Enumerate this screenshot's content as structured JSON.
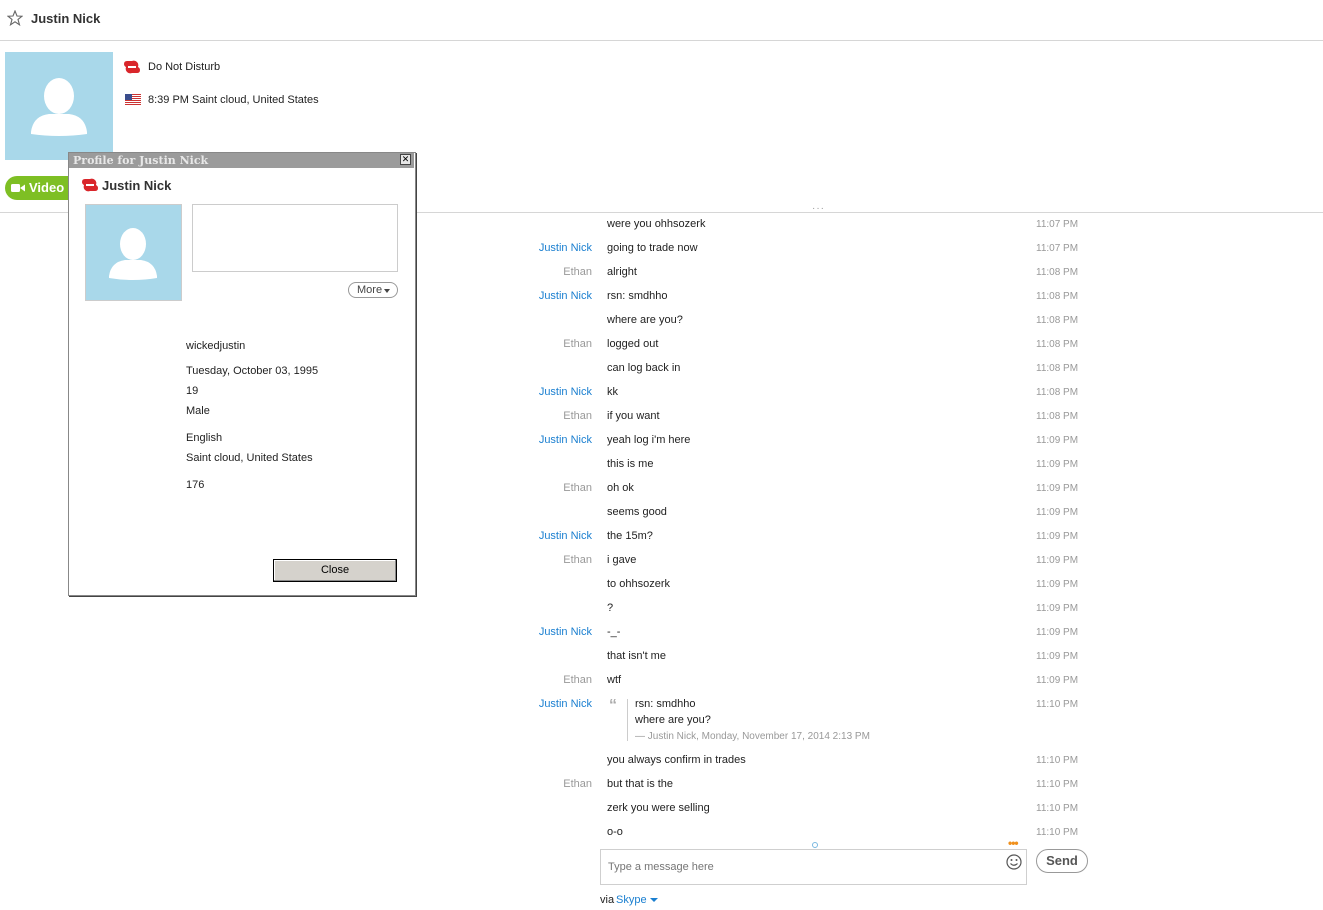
{
  "header": {
    "title": "Justin Nick"
  },
  "profile": {
    "status": "Do Not Disturb",
    "local_time_location": "8:39 PM Saint cloud, United States",
    "video_label": "Video"
  },
  "messages": [
    {
      "sender": "",
      "text": "were you ohhsozerk",
      "time": "11:07 PM",
      "who": ""
    },
    {
      "sender": "Justin Nick",
      "text": "going to trade now",
      "time": "11:07 PM",
      "who": "jn"
    },
    {
      "sender": "Ethan",
      "text": "alright",
      "time": "11:08 PM",
      "who": "et"
    },
    {
      "sender": "Justin Nick",
      "text": "rsn: smdhho",
      "time": "11:08 PM",
      "who": "jn"
    },
    {
      "sender": "",
      "text": "where are you?",
      "time": "11:08 PM",
      "who": ""
    },
    {
      "sender": "Ethan",
      "text": "logged out",
      "time": "11:08 PM",
      "who": "et"
    },
    {
      "sender": "",
      "text": "can log back in",
      "time": "11:08 PM",
      "who": ""
    },
    {
      "sender": "Justin Nick",
      "text": "kk",
      "time": "11:08 PM",
      "who": "jn"
    },
    {
      "sender": "Ethan",
      "text": "if you want",
      "time": "11:08 PM",
      "who": "et"
    },
    {
      "sender": "Justin Nick",
      "text": "yeah log i'm here",
      "time": "11:09 PM",
      "who": "jn"
    },
    {
      "sender": "",
      "text": "this is me",
      "time": "11:09 PM",
      "who": ""
    },
    {
      "sender": "Ethan",
      "text": "oh ok",
      "time": "11:09 PM",
      "who": "et"
    },
    {
      "sender": "",
      "text": "seems good",
      "time": "11:09 PM",
      "who": ""
    },
    {
      "sender": "Justin Nick",
      "text": "the 15m?",
      "time": "11:09 PM",
      "who": "jn"
    },
    {
      "sender": "Ethan",
      "text": "i gave",
      "time": "11:09 PM",
      "who": "et"
    },
    {
      "sender": "",
      "text": "to ohhsozerk",
      "time": "11:09 PM",
      "who": ""
    },
    {
      "sender": "",
      "text": "?",
      "time": "11:09 PM",
      "who": ""
    },
    {
      "sender": "Justin Nick",
      "text": "-_-",
      "time": "11:09 PM",
      "who": "jn"
    },
    {
      "sender": "",
      "text": "that isn't me",
      "time": "11:09 PM",
      "who": ""
    },
    {
      "sender": "Ethan",
      "text": "wtf",
      "time": "11:09 PM",
      "who": "et"
    }
  ],
  "quote_message": {
    "sender": "Justin Nick",
    "time": "11:10 PM",
    "quote_lines": [
      "rsn: smdhho",
      "where are you?"
    ],
    "attribution": "— Justin Nick, Monday, November 17, 2014 2:13 PM"
  },
  "messages_after": [
    {
      "sender": "",
      "text": "you always confirm in trades",
      "time": "11:10 PM",
      "who": ""
    },
    {
      "sender": "Ethan",
      "text": "but that is the",
      "time": "11:10 PM",
      "who": "et"
    },
    {
      "sender": "",
      "text": "zerk you were selling",
      "time": "11:10 PM",
      "who": ""
    },
    {
      "sender": "",
      "text": "o-o",
      "time": "11:10 PM",
      "who": ""
    }
  ],
  "composer": {
    "placeholder": "Type a message here",
    "send_label": "Send",
    "via_prefix": "via",
    "via_service": "Skype"
  },
  "dialog": {
    "title": "Profile for Justin Nick",
    "name": "Justin Nick",
    "more_label": "More",
    "fields": [
      "wickedjustin",
      "Tuesday, October 03, 1995",
      "19",
      "Male",
      "English",
      "Saint cloud, United States",
      "176"
    ],
    "close_label": "Close"
  },
  "colors": {
    "accent_blue": "#1a7fd0",
    "video_green": "#7ebf24",
    "dnd_red": "#d9262b",
    "avatar_bg": "#a9d8ea"
  }
}
